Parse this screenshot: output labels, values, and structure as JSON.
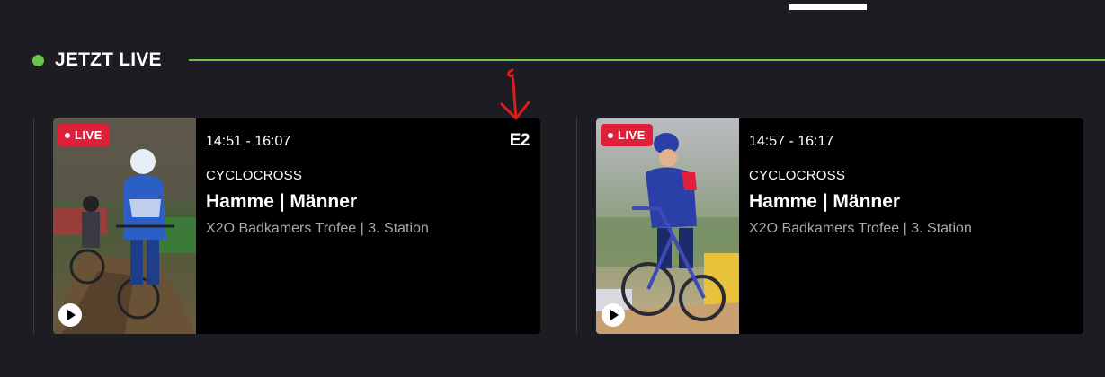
{
  "section": {
    "title": "JETZT LIVE"
  },
  "colors": {
    "accent": "#6cc24a",
    "live": "#e0203a",
    "background": "#1c1c22",
    "card": "#000000"
  },
  "cards": [
    {
      "badge": "LIVE",
      "time": "14:51 - 16:07",
      "sport": "CYCLOCROSS",
      "title": "Hamme | Männer",
      "subtitle": "X2O Badkamers Trofee | 3. Station",
      "channel": "E2",
      "thumbnail_icon": "cyclocross-photo"
    },
    {
      "badge": "LIVE",
      "time": "14:57 - 16:17",
      "sport": "CYCLOCROSS",
      "title": "Hamme | Männer",
      "subtitle": "X2O Badkamers Trofee | 3. Station",
      "thumbnail_icon": "cyclocross-photo"
    }
  ],
  "icons": {
    "play": "play-icon",
    "live_dot": "live-dot-icon",
    "arrow": "annotation-arrow-icon"
  }
}
